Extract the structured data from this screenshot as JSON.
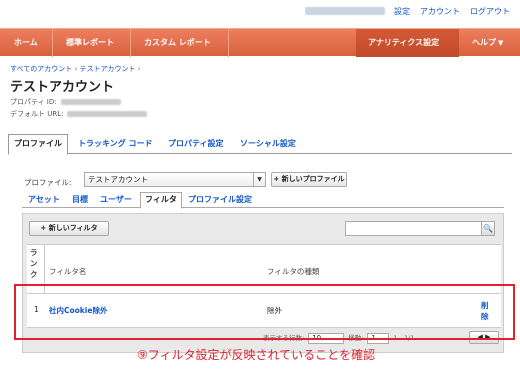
{
  "top_links": {
    "settings": "設定",
    "account": "アカウント",
    "logout": "ログアウト"
  },
  "nav": {
    "home": "ホーム",
    "standard_reports": "標準レポート",
    "custom_reports": "カスタム レポート",
    "analytics_settings": "アナリティクス設定",
    "help": "ヘルプ"
  },
  "breadcrumb": {
    "all_accounts": "すべてのアカウント",
    "account": "テストアカウント",
    "separator": "›"
  },
  "page_title": "テストアカウント",
  "property_id_label": "プロパティ ID:",
  "default_url_label": "デフォルト URL:",
  "property_tabs": [
    "プロファイル",
    "トラッキング コード",
    "プロパティ設定",
    "ソーシャル設定"
  ],
  "profile_label": "プロファイル:",
  "profile_selected": "テストアカウント",
  "new_profile_button": "+ 新しいプロファイル",
  "sub_tabs": [
    "アセット",
    "目標",
    "ユーザー",
    "フィルタ",
    "プロファイル設定"
  ],
  "new_filter_button": "+ 新しいフィルタ",
  "table": {
    "headers": {
      "rank": "ランク",
      "filter_name": "フィルタ名",
      "filter_type": "フィルタの種類"
    },
    "rows": [
      {
        "rank": "1",
        "name": "社内Cookie除外",
        "type": "除外",
        "action": "削除"
      }
    ]
  },
  "pager": {
    "show_rows_label": "表示する行数:",
    "rows_value": "10",
    "goto_label": "移動:",
    "goto_value": "1",
    "range": "1 - 1/1"
  },
  "caption": "⑨フィルタ設定が反映されていることを確認",
  "colors": {
    "nav_orange": "#e06a47",
    "highlight_red": "#e0222c",
    "link_blue": "#1155cc"
  }
}
